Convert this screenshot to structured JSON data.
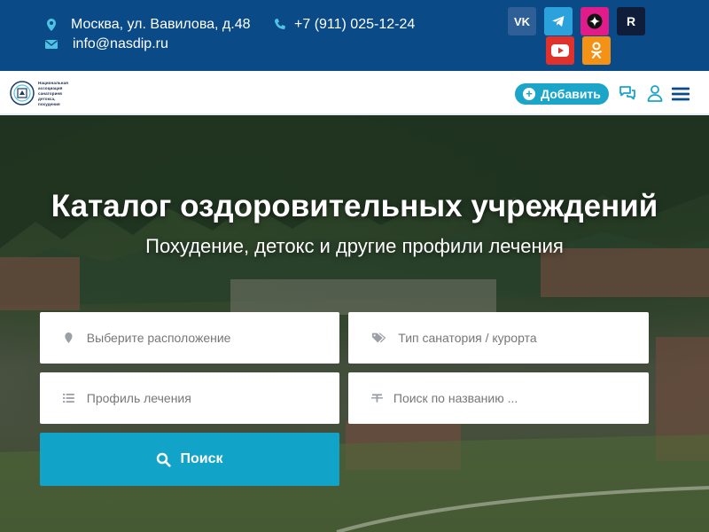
{
  "topbar": {
    "address": "Москва, ул. Вавилова, д.48",
    "phone": "+7 (911) 025-12-24",
    "email": "info@nasdip.ru",
    "social": [
      {
        "name": "vk",
        "glyph": "VK"
      },
      {
        "name": "telegram",
        "glyph": ""
      },
      {
        "name": "dzen",
        "glyph": "✦"
      },
      {
        "name": "rutube",
        "glyph": "R"
      },
      {
        "name": "youtube",
        "glyph": "▶"
      },
      {
        "name": "odnoklassniki",
        "glyph": ""
      }
    ]
  },
  "logo": {
    "lines": [
      "Национальная",
      "ассоциация",
      "санаториев",
      "детокса,",
      "похудения"
    ]
  },
  "nav": {
    "add_label": "Добавить"
  },
  "hero": {
    "title": "Каталог оздоровительных учреждений",
    "subtitle": "Похудение, детокс и другие профили лечения"
  },
  "search": {
    "location_placeholder": "Выберите расположение",
    "type_placeholder": "Тип санатория / курорта",
    "profile_placeholder": "Профиль лечения",
    "name_placeholder": "Поиск по названию ...",
    "button_label": "Поиск"
  },
  "colors": {
    "topbar_bg": "#0a4a86",
    "accent": "#1aa5c9",
    "icon_cyan": "#4ec3e6"
  }
}
